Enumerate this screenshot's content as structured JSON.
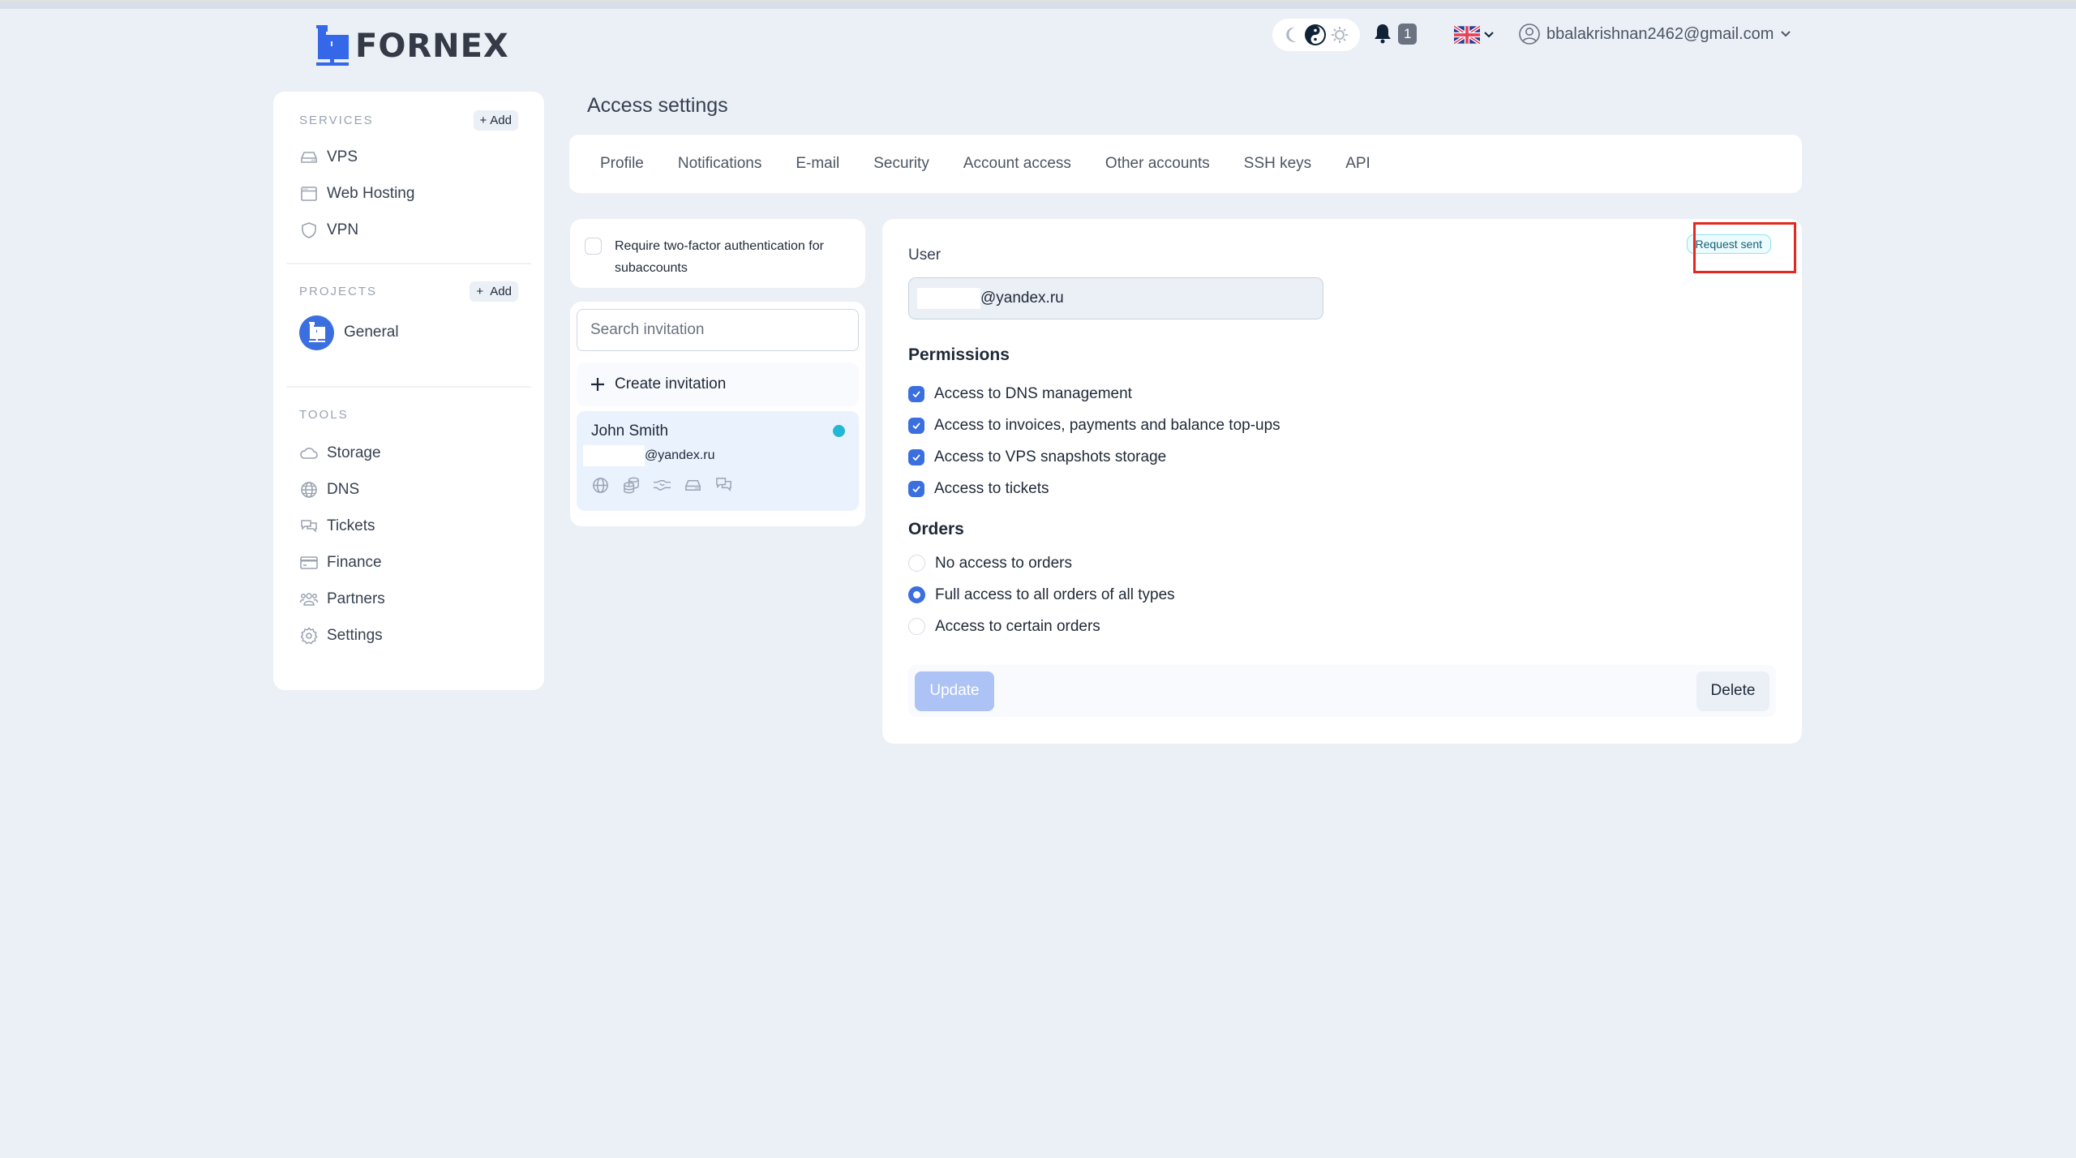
{
  "header": {
    "logo_text": "FORNEX",
    "notifications_count": "1",
    "language": "en-GB",
    "account_email": "bbalakrishnan2462@gmail.com",
    "theme_options": [
      "dark",
      "auto",
      "light"
    ],
    "theme_selected": "auto"
  },
  "sidebar": {
    "services": {
      "title": "SERVICES",
      "add_label": "Add",
      "items": [
        {
          "label": "VPS",
          "icon": "server-icon"
        },
        {
          "label": "Web Hosting",
          "icon": "browser-window-icon"
        },
        {
          "label": "VPN",
          "icon": "shield-icon"
        }
      ]
    },
    "projects": {
      "title": "PROJECTS",
      "add_label": "Add",
      "items": [
        {
          "label": "General",
          "icon": "fornex-logo-icon"
        }
      ]
    },
    "tools": {
      "title": "TOOLS",
      "items": [
        {
          "label": "Storage",
          "icon": "cloud-icon"
        },
        {
          "label": "DNS",
          "icon": "globe-icon"
        },
        {
          "label": "Tickets",
          "icon": "chat-bubbles-icon"
        },
        {
          "label": "Finance",
          "icon": "credit-card-icon"
        },
        {
          "label": "Partners",
          "icon": "users-group-icon"
        },
        {
          "label": "Settings",
          "icon": "gear-icon"
        }
      ]
    }
  },
  "main": {
    "title": "Access settings",
    "tabs": [
      {
        "label": "Profile"
      },
      {
        "label": "Notifications"
      },
      {
        "label": "E-mail"
      },
      {
        "label": "Security"
      },
      {
        "label": "Account access",
        "active": true
      },
      {
        "label": "Other accounts"
      },
      {
        "label": "SSH keys"
      },
      {
        "label": "API"
      }
    ],
    "twofa": {
      "label": "Require two-factor authentication for subaccounts",
      "checked": false
    },
    "invitations": {
      "search_placeholder": "Search invitation",
      "search_value": "",
      "create_label": "Create invitation",
      "items": [
        {
          "name": "John Smith",
          "email_suffix": "@yandex.ru",
          "status_color": "#22b8d3",
          "permission_icons": [
            "globe-icon",
            "coins-icon",
            "handshake-icon",
            "server-icon",
            "chat-bubbles-icon"
          ]
        }
      ]
    },
    "detail": {
      "status_badge": "Request sent",
      "user_label": "User",
      "user_email_suffix": "@yandex.ru",
      "permissions_title": "Permissions",
      "permissions": [
        {
          "label": "Access to DNS management",
          "checked": true
        },
        {
          "label": "Access to invoices, payments and balance top-ups",
          "checked": true
        },
        {
          "label": "Access to VPS snapshots storage",
          "checked": true
        },
        {
          "label": "Access to tickets",
          "checked": true
        }
      ],
      "orders_title": "Orders",
      "orders": [
        {
          "label": "No access to orders",
          "selected": false
        },
        {
          "label": "Full access to all orders of all types",
          "selected": true
        },
        {
          "label": "Access to certain orders",
          "selected": false
        }
      ],
      "update_label": "Update",
      "delete_label": "Delete"
    }
  },
  "colors": {
    "accent": "#3b6fe0",
    "background": "#ebeff6",
    "badge_border": "#8ee3ef",
    "highlight": "#e5281f"
  }
}
